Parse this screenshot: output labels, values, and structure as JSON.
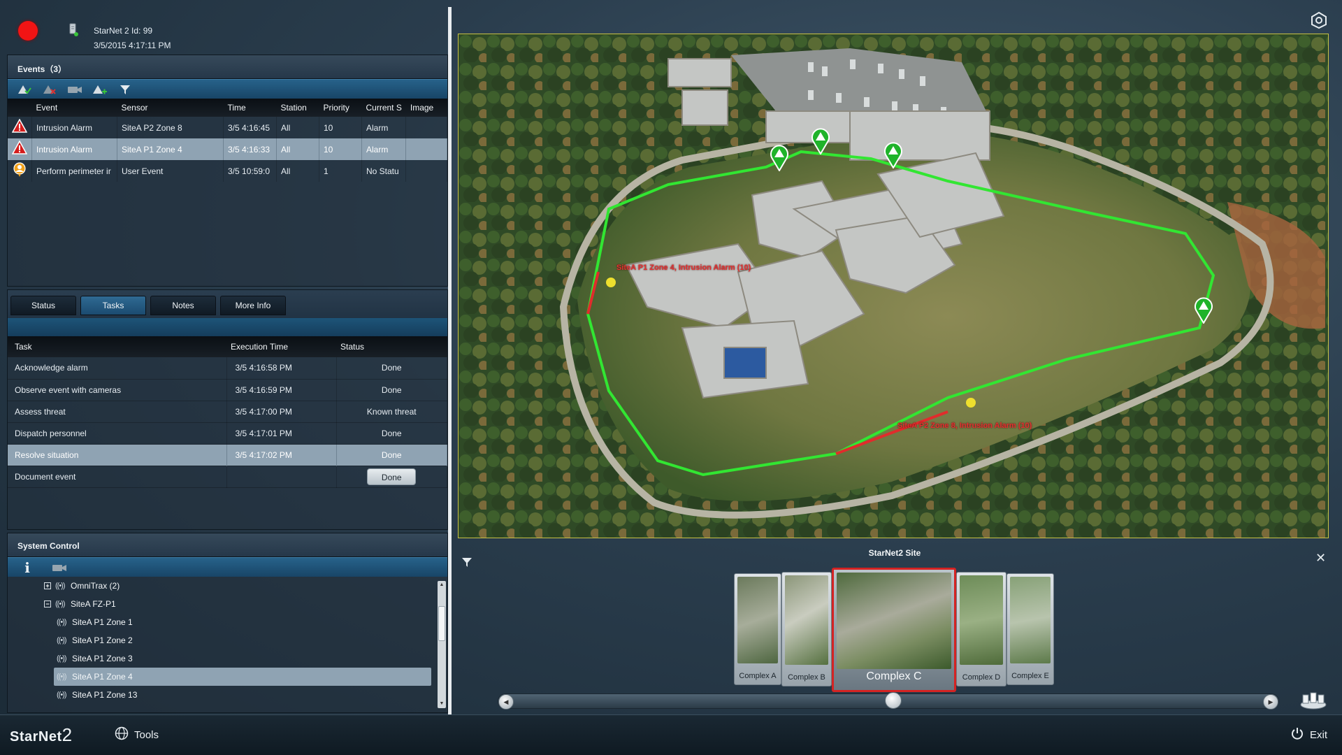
{
  "header": {
    "station_title": "StarNet 2 Id: 99",
    "station_time": "3/5/2015 4:17:11 PM",
    "recording_color": "#f21414"
  },
  "events": {
    "title": "Events（3）",
    "toolbar": [
      "acknowledge-icon",
      "clear-icon",
      "camera-icon",
      "add-event-icon",
      "filter-icon"
    ],
    "columns": [
      "Event",
      "Sensor",
      "Time",
      "Station",
      "Priority",
      "Current S",
      "Image"
    ],
    "rows": [
      {
        "icon": "alarm-triangle-icon",
        "event": "Intrusion Alarm",
        "sensor": "SiteA P2 Zone 8",
        "time": "3/5 4:16:45",
        "station": "All",
        "priority": "10",
        "status": "Alarm",
        "image": ""
      },
      {
        "icon": "alarm-triangle-icon",
        "event": "Intrusion Alarm",
        "sensor": "SiteA P1 Zone 4",
        "time": "3/5 4:16:33",
        "station": "All",
        "priority": "10",
        "status": "Alarm",
        "image": ""
      },
      {
        "icon": "user-event-icon",
        "event": "Perform perimeter ir",
        "sensor": "User Event",
        "time": "3/5 10:59:0",
        "station": "All",
        "priority": "1",
        "status": "No Statu",
        "image": ""
      }
    ]
  },
  "detail_tabs": {
    "tabs": [
      "Status",
      "Tasks",
      "Notes",
      "More Info"
    ],
    "active": "Tasks",
    "columns": [
      "Task",
      "Execution Time",
      "Status"
    ],
    "rows": [
      {
        "task": "Acknowledge alarm",
        "time": "3/5 4:16:58 PM",
        "status": "Done"
      },
      {
        "task": "Observe event with cameras",
        "time": "3/5 4:16:59 PM",
        "status": "Done"
      },
      {
        "task": "Assess threat",
        "time": "3/5 4:17:00 PM",
        "status": "Known threat"
      },
      {
        "task": "Dispatch personnel",
        "time": "3/5 4:17:01 PM",
        "status": "Done"
      },
      {
        "task": "Resolve situation",
        "time": "3/5 4:17:02 PM",
        "status": "Done"
      },
      {
        "task": "Document event",
        "time": "",
        "status": "Done"
      }
    ]
  },
  "system_control": {
    "title": "System Control",
    "toolbar": [
      "info-icon",
      "camera-icon"
    ],
    "tree": [
      {
        "label": "OmniTrax (2)",
        "expander": "+",
        "selected": false
      },
      {
        "label": "SiteA FZ-P1",
        "expander": "−",
        "selected": false
      },
      {
        "label": "SiteA P1 Zone 1",
        "expander": "",
        "selected": false
      },
      {
        "label": "SiteA P1 Zone 2",
        "expander": "",
        "selected": false
      },
      {
        "label": "SiteA P1 Zone 3",
        "expander": "",
        "selected": false
      },
      {
        "label": "SiteA P1 Zone 4",
        "expander": "",
        "selected": true
      },
      {
        "label": "SiteA P1 Zone 13",
        "expander": "",
        "selected": false
      }
    ]
  },
  "map": {
    "alarm_labels": [
      "SiteA P1 Zone 4, Intrusion Alarm (10)",
      "SiteA P2 Zone 8, Intrusion Alarm (10)"
    ],
    "perimeter_color": "#32e632",
    "alarm_color": "#e02c2c",
    "marker_icon": "green-alarm-marker-icon"
  },
  "site_selector": {
    "title": "StarNet2 Site",
    "cards": [
      "Complex A",
      "Complex B",
      "Complex C",
      "Complex D",
      "Complex E"
    ],
    "selected": "Complex C"
  },
  "bottom_bar": {
    "logo": "StarNet",
    "logo_num": "2",
    "tools": "Tools",
    "exit": "Exit"
  }
}
